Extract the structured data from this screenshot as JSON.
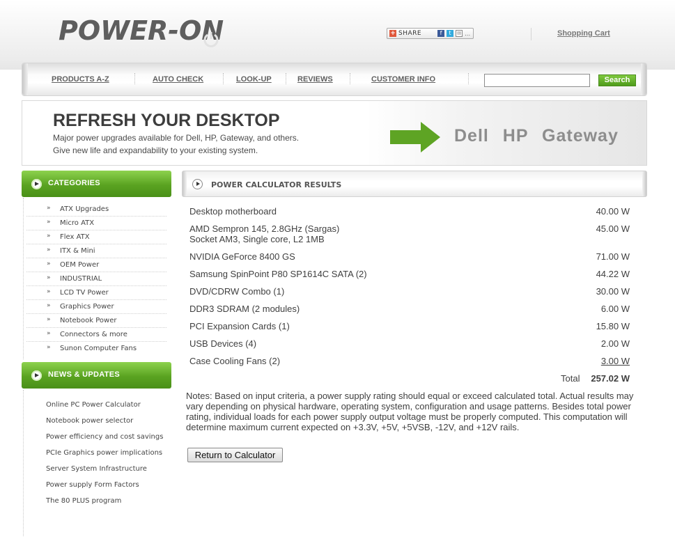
{
  "header": {
    "logo_text": "POWER-ON",
    "share_label": "SHARE",
    "cart_link": "Shopping Cart"
  },
  "nav": {
    "items": [
      {
        "label": "PRODUCTS A-Z"
      },
      {
        "label": "AUTO CHECK"
      },
      {
        "label": "LOOK-UP"
      },
      {
        "label": "REVIEWS"
      },
      {
        "label": "CUSTOMER INFO"
      }
    ],
    "search_value": "",
    "search_button": "Search"
  },
  "banner": {
    "title": "REFRESH YOUR DESKTOP",
    "line1": "Major power upgrades available for Dell, HP, Gateway, and others.",
    "line2": "Give new life and expandability to your existing system.",
    "brands": "Dell HP Gateway"
  },
  "sidebar": {
    "categories_title": "CATEGORIES",
    "categories": [
      "ATX Upgrades",
      "Micro ATX",
      "Flex ATX",
      "ITX & Mini",
      "OEM Power",
      "INDUSTRIAL",
      "LCD TV Power",
      "Graphics Power",
      "Notebook Power",
      "Connectors & more",
      "Sunon Computer Fans"
    ],
    "news_title": "NEWS & UPDATES",
    "news": [
      "Online PC Power Calculator",
      "Notebook power selector",
      "Power efficiency and cost savings",
      "PCIe Graphics power implications",
      "Server System Infrastructure",
      "Power supply Form Factors",
      "The 80 PLUS program"
    ]
  },
  "main": {
    "title": "POWER CALCULATOR RESULTS",
    "rows": [
      {
        "name": "Desktop motherboard",
        "watts": "40.00 W"
      },
      {
        "name": "AMD Sempron 145, 2.8GHz (Sargas)",
        "name2": "Socket AM3, Single core, L2 1MB",
        "watts": "45.00 W"
      },
      {
        "name": "NVIDIA GeForce 8400 GS",
        "watts": "71.00 W"
      },
      {
        "name": "Samsung SpinPoint P80 SP1614C SATA (2)",
        "watts": "44.22 W"
      },
      {
        "name": "DVD/CDRW Combo (1)",
        "watts": "30.00 W"
      },
      {
        "name": "DDR3 SDRAM (2 modules)",
        "watts": "6.00 W"
      },
      {
        "name": "PCI Expansion Cards (1)",
        "watts": "15.80 W"
      },
      {
        "name": "USB Devices (4)",
        "watts": "2.00 W"
      },
      {
        "name": "Case Cooling Fans (2)",
        "watts": "3.00 W"
      }
    ],
    "total_label": "Total",
    "total_value": "257.02 W",
    "notes": "Notes: Based on input criteria, a power supply rating should equal or exceed calculated total. Actual results may vary depending on physical hardware, operating system, configuration and usage patterns. Besides total power rating, individual loads for each power supply output voltage must be properly computed. This computation will determine maximum current expected on +3.3V, +5V, +5VSB, -12V, and +12V rails.",
    "return_button": "Return to Calculator"
  },
  "colors": {
    "accent_green": "#5aa321",
    "text_gray": "#444444"
  }
}
